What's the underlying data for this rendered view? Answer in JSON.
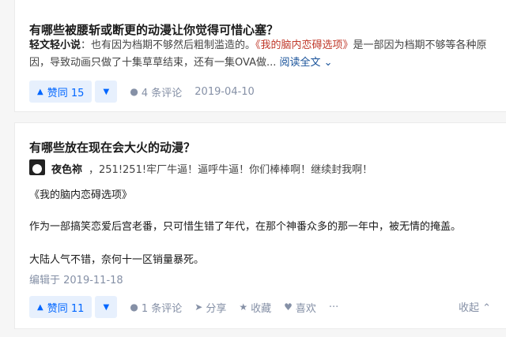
{
  "card1": {
    "question": "有哪些被腰斩或断更的动漫让你觉得可惜心塞？",
    "author": "轻文轻小说",
    "excerpt_before": "：也有因为档期不够然后粗制滥造的。",
    "book_title": "《我的脑内恋碍选项》",
    "excerpt_after_line1": "是一部因为档期不够等各种原",
    "excerpt_line2": "因，导致动画只做了十集草草结束，还有一集OVA做...",
    "read_more": "阅读全文",
    "vote_label": "赞同 15",
    "comments": "4 条评论",
    "date": "2019-04-10"
  },
  "card2": {
    "question": "有哪些放在现在会大火的动漫？",
    "author_name": "夜色祢",
    "author_bio": "，251!251!牢厂牛逼！逼呼牛逼！你们棒棒啊！继续封我啊！",
    "para1": "《我的脑内恋碍选项》",
    "para2": "作为一部搞笑恋爱后宫老番，只可惜生错了年代，在那个神番众多的那一年中，被无情的掩盖。",
    "para3": "大陆人气不错，奈何十一区销量暴死。",
    "edited": "编辑于 2019-11-18",
    "vote_label": "赞同 11",
    "comments": "1 条评论",
    "share": "分享",
    "favorite": "收藏",
    "like": "喜欢",
    "collapse": "收起"
  },
  "colors": {
    "accent": "#0066ff",
    "vote_bg": "#e7f0fd",
    "link": "#175199",
    "book_red": "#c0392b",
    "meta_gray": "#8590a6"
  }
}
